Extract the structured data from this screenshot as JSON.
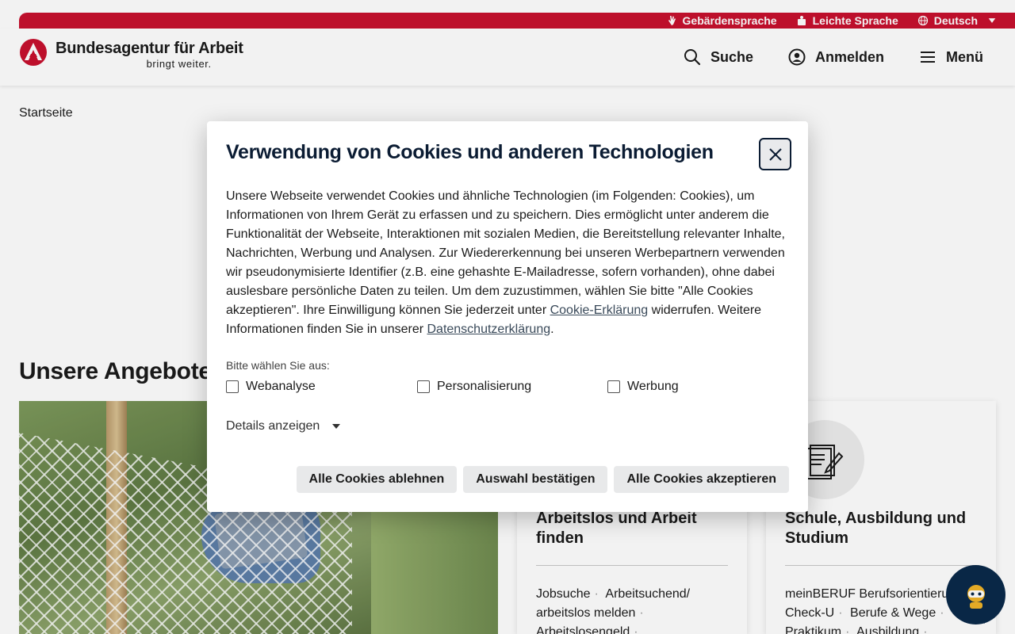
{
  "colors": {
    "brand_red": "#c8102e",
    "dark_navy": "#0b1c33",
    "chatbot_bg": "#0a2a4a"
  },
  "topbar": {
    "items": [
      {
        "label": "Gebärdensprache",
        "icon": "sign-language-icon"
      },
      {
        "label": "Leichte Sprache",
        "icon": "easy-language-icon"
      },
      {
        "label": "Deutsch",
        "icon": "globe-icon"
      }
    ]
  },
  "header": {
    "logo": {
      "name": "Bundesagentur für Arbeit",
      "slogan": "bringt weiter."
    },
    "nav": [
      {
        "label": "Suche",
        "icon": "search-icon"
      },
      {
        "label": "Anmelden",
        "icon": "user-icon"
      },
      {
        "label": "Menü",
        "icon": "menu-icon"
      }
    ]
  },
  "breadcrumb": "Startseite",
  "main": {
    "section_title": "Unsere Angebote f",
    "cards": [
      {
        "title": "Arbeitslos und Arbeit finden",
        "icon": "search-person-icon",
        "links": [
          "Jobsuche",
          "Arbeitsuchend/ arbeitslos melden",
          "Arbeitslosengeld"
        ]
      },
      {
        "title": "Schule, Ausbildung und Studium",
        "icon": "document-pen-icon",
        "links": [
          "meinBERUF Berufsorientierung",
          "Check-U",
          "Berufe & Wege",
          "Praktikum",
          "Ausbildung"
        ]
      }
    ]
  },
  "dialog": {
    "title": "Verwendung von Cookies und anderen Technologien",
    "text_part1": "Unsere Webseite verwendet Cookies und ähnliche Technologien (im Folgenden: Cookies), um Informationen von Ihrem Gerät zu erfassen und zu speichern. Dies ermöglicht unter anderem die Funktionalität der Webseite, Interaktionen mit sozialen Medien, die Bereitstellung relevanter Inhalte, Nachrichten, Werbung und Analysen. Zur Wiedererkennung bei unseren Werbepartnern verwenden wir pseudonymisierte Identifier (z.B. eine gehashte E-Mailadresse, sofern vorhanden), ohne dabei auslesbare persönliche Daten zu teilen. Um dem zuzustimmen, wählen Sie bitte \"Alle Cookies akzeptieren\". Ihre Einwilligung können Sie jederzeit unter ",
    "link_cookie": "Cookie-Erklärung",
    "text_part2": " widerrufen. Weitere Informationen finden Sie in unserer ",
    "link_privacy": "Datenschutzerklärung",
    "text_part3": ".",
    "choose_label": "Bitte wählen Sie aus:",
    "options": [
      {
        "label": "Webanalyse",
        "checked": false
      },
      {
        "label": "Personalisierung",
        "checked": false
      },
      {
        "label": "Werbung",
        "checked": false
      }
    ],
    "details_label": "Details anzeigen",
    "buttons": {
      "reject": "Alle Cookies ablehnen",
      "confirm": "Auswahl bestätigen",
      "accept": "Alle Cookies akzeptieren"
    }
  }
}
